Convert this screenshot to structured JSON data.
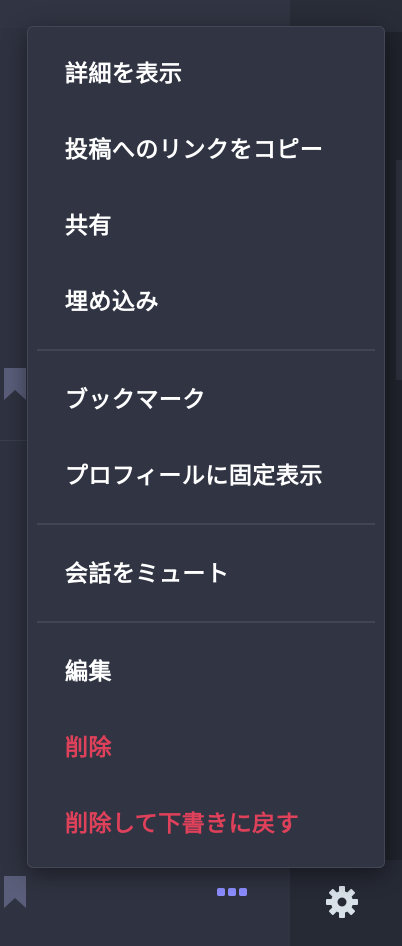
{
  "menu": {
    "items": [
      {
        "label": "詳細を表示",
        "type": "normal"
      },
      {
        "label": "投稿へのリンクをコピー",
        "type": "normal"
      },
      {
        "label": "共有",
        "type": "normal"
      },
      {
        "label": "埋め込み",
        "type": "normal"
      },
      {
        "label": "ブックマーク",
        "type": "normal"
      },
      {
        "label": "プロフィールに固定表示",
        "type": "normal"
      },
      {
        "label": "会話をミュート",
        "type": "normal"
      },
      {
        "label": "編集",
        "type": "normal"
      },
      {
        "label": "削除",
        "type": "danger"
      },
      {
        "label": "削除して下書きに戻す",
        "type": "danger"
      }
    ]
  },
  "icons": {
    "bookmark": "bookmark-icon",
    "more": "more-horizontal-icon",
    "settings": "gear-icon"
  },
  "colors": {
    "background": "#282c37",
    "menu_background": "#313543",
    "menu_text": "#ffffff",
    "danger_text": "#df405a",
    "bookmark_icon": "#5a5e7a",
    "more_icon": "#8c8dff",
    "gear_icon": "#d9e1e8"
  }
}
